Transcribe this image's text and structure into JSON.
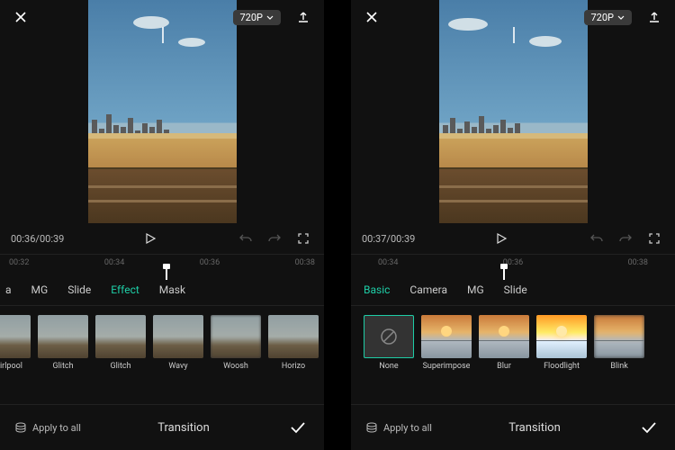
{
  "accent": "#1ecda6",
  "panels": [
    {
      "resolution": "720P",
      "time_current": "00:36",
      "time_total": "00:39",
      "ticks": [
        "00:32",
        "00:34",
        "00:36",
        "00:38"
      ],
      "playhead_pct": 50,
      "tabs": [
        {
          "label": "a",
          "active": false,
          "partial": true
        },
        {
          "label": "MG",
          "active": false
        },
        {
          "label": "Slide",
          "active": false
        },
        {
          "label": "Effect",
          "active": true
        },
        {
          "label": "Mask",
          "active": false
        }
      ],
      "thumbs": [
        {
          "label": "Whirlpool"
        },
        {
          "label": "Glitch"
        },
        {
          "label": "Glitch"
        },
        {
          "label": "Wavy"
        },
        {
          "label": "Woosh"
        },
        {
          "label": "Horizo"
        }
      ],
      "apply_label": "Apply to all",
      "bottom_title": "Transition"
    },
    {
      "resolution": "720P",
      "time_current": "00:37",
      "time_total": "00:39",
      "ticks": [
        "00:34",
        "00:36",
        "00:38"
      ],
      "playhead_pct": 46,
      "tabs": [
        {
          "label": "Basic",
          "active": true
        },
        {
          "label": "Camera",
          "active": false
        },
        {
          "label": "MG",
          "active": false
        },
        {
          "label": "Slide",
          "active": false
        }
      ],
      "thumbs": [
        {
          "label": "None",
          "none": true,
          "selected": true
        },
        {
          "label": "Superimpose"
        },
        {
          "label": "Blur"
        },
        {
          "label": "Floodlight"
        },
        {
          "label": "Blink"
        }
      ],
      "apply_label": "Apply to all",
      "bottom_title": "Transition"
    }
  ]
}
